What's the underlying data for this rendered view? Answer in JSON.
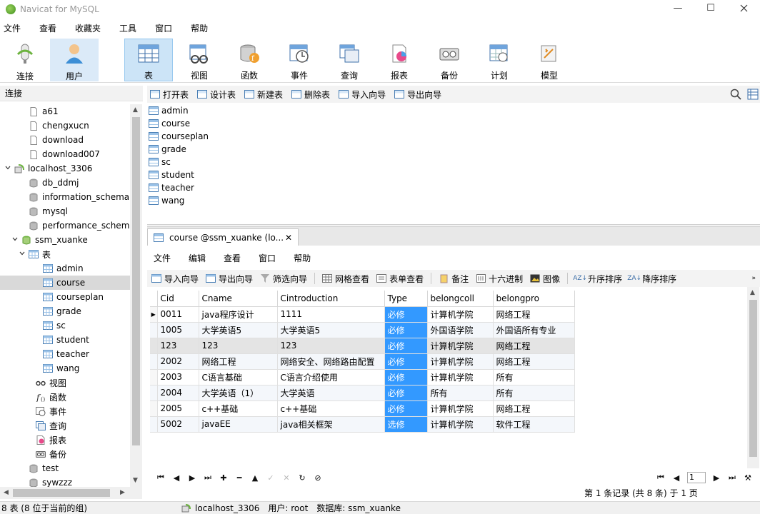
{
  "window": {
    "title": "Navicat for MySQL",
    "controls": {
      "minimize": "—",
      "maximize": "☐"
    }
  },
  "menubar": [
    "文件",
    "查看",
    "收藏夹",
    "工具",
    "窗口",
    "帮助"
  ],
  "ribbon": [
    {
      "label": "连接",
      "icon": "connect-icon"
    },
    {
      "label": "用户",
      "icon": "user-icon"
    },
    {
      "label": "表",
      "icon": "table-icon"
    },
    {
      "label": "视图",
      "icon": "view-icon"
    },
    {
      "label": "函数",
      "icon": "function-icon"
    },
    {
      "label": "事件",
      "icon": "event-icon"
    },
    {
      "label": "查询",
      "icon": "query-icon"
    },
    {
      "label": "报表",
      "icon": "report-icon"
    },
    {
      "label": "备份",
      "icon": "backup-icon"
    },
    {
      "label": "计划",
      "icon": "schedule-icon"
    },
    {
      "label": "模型",
      "icon": "model-icon"
    }
  ],
  "left_pane": {
    "header": "连接",
    "tree": [
      {
        "label": "a61",
        "icon": "file",
        "level": 2,
        "toggle": ""
      },
      {
        "label": "chengxucn",
        "icon": "file",
        "level": 2,
        "toggle": ""
      },
      {
        "label": "download",
        "icon": "file",
        "level": 2,
        "toggle": ""
      },
      {
        "label": "download007",
        "icon": "file",
        "level": 2,
        "toggle": ""
      },
      {
        "label": "localhost_3306",
        "icon": "server",
        "level": 0,
        "toggle": "v"
      },
      {
        "label": "db_ddmj",
        "icon": "db",
        "level": 2,
        "toggle": ""
      },
      {
        "label": "information_schema",
        "icon": "db",
        "level": 2,
        "toggle": ""
      },
      {
        "label": "mysql",
        "icon": "db",
        "level": 2,
        "toggle": ""
      },
      {
        "label": "performance_schem",
        "icon": "db",
        "level": 2,
        "toggle": ""
      },
      {
        "label": "ssm_xuanke",
        "icon": "db-open",
        "level": 1,
        "toggle": "v"
      },
      {
        "label": "表",
        "icon": "table",
        "level": 2,
        "toggle": "v"
      },
      {
        "label": "admin",
        "icon": "table",
        "level": 4,
        "toggle": ""
      },
      {
        "label": "course",
        "icon": "table",
        "level": 4,
        "toggle": "",
        "selected": true
      },
      {
        "label": "courseplan",
        "icon": "table",
        "level": 4,
        "toggle": ""
      },
      {
        "label": "grade",
        "icon": "table",
        "level": 4,
        "toggle": ""
      },
      {
        "label": "sc",
        "icon": "table",
        "level": 4,
        "toggle": ""
      },
      {
        "label": "student",
        "icon": "table",
        "level": 4,
        "toggle": ""
      },
      {
        "label": "teacher",
        "icon": "table",
        "level": 4,
        "toggle": ""
      },
      {
        "label": "wang",
        "icon": "table",
        "level": 4,
        "toggle": ""
      },
      {
        "label": "视图",
        "icon": "view",
        "level": 3,
        "toggle": ""
      },
      {
        "label": "函数",
        "icon": "function",
        "level": 3,
        "toggle": ""
      },
      {
        "label": "事件",
        "icon": "event",
        "level": 3,
        "toggle": ""
      },
      {
        "label": "查询",
        "icon": "query",
        "level": 3,
        "toggle": ""
      },
      {
        "label": "报表",
        "icon": "report",
        "level": 3,
        "toggle": ""
      },
      {
        "label": "备份",
        "icon": "backup",
        "level": 3,
        "toggle": ""
      },
      {
        "label": "test",
        "icon": "db",
        "level": 2,
        "toggle": ""
      },
      {
        "label": "sywzzz",
        "icon": "db",
        "level": 2,
        "toggle": ""
      }
    ]
  },
  "object_toolbar": [
    "打开表",
    "设计表",
    "新建表",
    "删除表",
    "导入向导",
    "导出向导"
  ],
  "object_list": [
    "admin",
    "course",
    "courseplan",
    "grade",
    "sc",
    "student",
    "teacher",
    "wang"
  ],
  "doc_tab": {
    "label": "course @ssm_xuanke (lo...",
    "close": "✕"
  },
  "inner_menu": [
    "文件",
    "编辑",
    "查看",
    "窗口",
    "帮助"
  ],
  "inner_toolbar": [
    "导入向导",
    "导出向导",
    "筛选向导",
    "网格查看",
    "表单查看",
    "备注",
    "十六进制",
    "图像",
    "升序排序",
    "降序排序"
  ],
  "grid": {
    "columns": [
      "Cid",
      "Cname",
      "Cintroduction",
      "Type",
      "belongcoll",
      "belongpro"
    ],
    "rows": [
      [
        "0011",
        "java程序设计",
        "1111",
        "必修",
        "计算机学院",
        "网络工程"
      ],
      [
        "1005",
        "大学英语5",
        "大学英语5",
        "必修",
        "外国语学院",
        "外国语所有专业"
      ],
      [
        "123",
        "123",
        "123",
        "必修",
        "计算机学院",
        "网络工程"
      ],
      [
        "2002",
        "网络工程",
        "网络安全、网络路由配置",
        "必修",
        "计算机学院",
        "网络工程"
      ],
      [
        "2003",
        "C语言基础",
        "C语言介绍使用",
        "必修",
        "计算机学院",
        "所有"
      ],
      [
        "2004",
        "大学英语（1）",
        "大学英语",
        "必修",
        "所有",
        "所有"
      ],
      [
        "2005",
        "c++基础",
        "c++基础",
        "必修",
        "计算机学院",
        "网络工程"
      ],
      [
        "5002",
        "javaEE",
        "java相关框架",
        "选修",
        "计算机学院",
        "软件工程"
      ]
    ],
    "current_row_marker": "▶"
  },
  "navigation": {
    "page": "1"
  },
  "record_info": "第 1 条记录 (共 8 条) 于 1 页",
  "status": {
    "left": "8 表 (8 位于当前的组)",
    "connection": "localhost_3306",
    "user": "用户: root",
    "database": "数据库: ssm_xuanke"
  }
}
